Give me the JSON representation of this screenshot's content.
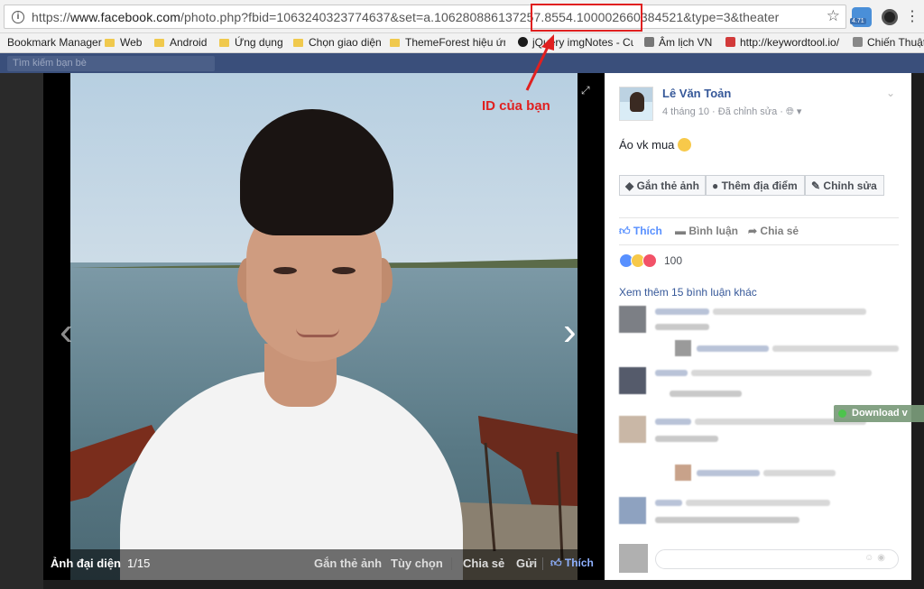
{
  "browser": {
    "url_scheme": "https://",
    "url_host": "www.facebook.com",
    "url_path": "/photo.php?fbid=1063240323774637&set=a.106280886137257.8554.",
    "url_id": "100002660384521",
    "url_tail": "&type=3&theater",
    "ext_badge": "4.71",
    "bookmarks": [
      {
        "label": "Bookmark Manager",
        "kind": "none"
      },
      {
        "label": "Web",
        "kind": "folder"
      },
      {
        "label": "Android",
        "kind": "folder"
      },
      {
        "label": "Ứng dụng",
        "kind": "folder"
      },
      {
        "label": "Chọn giao diện",
        "kind": "folder"
      },
      {
        "label": "ThemeForest hiệu ứng",
        "kind": "folder"
      },
      {
        "label": "jQuery imgNotes - Cu",
        "kind": "site"
      },
      {
        "label": "Âm lịch VN",
        "kind": "site"
      },
      {
        "label": "http://keywordtool.io/",
        "kind": "site"
      },
      {
        "label": "Chiến Thuật",
        "kind": "site"
      }
    ]
  },
  "fb": {
    "search_placeholder": "Tìm kiếm bạn bè"
  },
  "annotation": {
    "label": "ID của bạn",
    "color": "#e02020"
  },
  "photo_bar": {
    "album": "Ảnh đại diện",
    "counter": "1/15",
    "tag": "Gắn thẻ ảnh",
    "options": "Tùy chọn",
    "share": "Chia sẻ",
    "send": "Gửi",
    "like": "Thích"
  },
  "post": {
    "author": "Lê Văn Toản",
    "date": "4 tháng 10",
    "edited": "Đã chỉnh sửa",
    "caption": "Áo vk mua",
    "tag_buttons": [
      "Gắn thẻ ảnh",
      "Thêm địa điểm",
      "Chỉnh sửa"
    ],
    "actions": {
      "like": "Thích",
      "comment": "Bình luận",
      "share": "Chia sẻ"
    },
    "reactions_count": "100",
    "more_comments": "Xem thêm 15 bình luận khác",
    "download_badge": "Download v"
  },
  "colors": {
    "fb_blue": "#365899",
    "liked_blue": "#5890ff",
    "annotation_red": "#e02020"
  }
}
